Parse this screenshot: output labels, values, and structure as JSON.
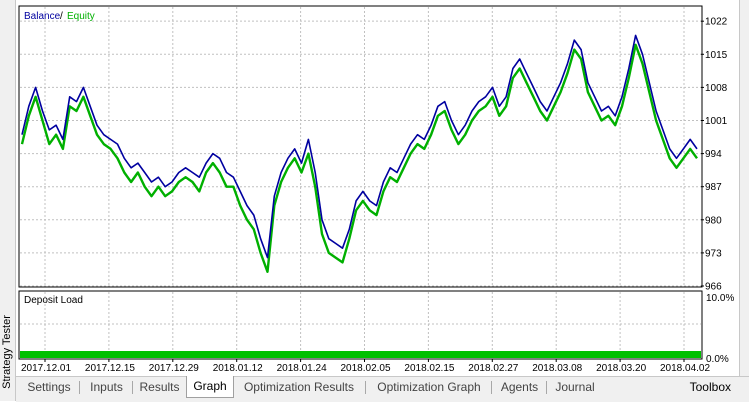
{
  "window": {
    "side_label": "Strategy Tester"
  },
  "legend": {
    "balance_label": "Balance",
    "separator": " / ",
    "equity_label": "Equity",
    "balance_color": "#0000a0",
    "equity_color": "#00b000"
  },
  "deposit_panel": {
    "title": "Deposit Load",
    "axis_top": "10.0%",
    "axis_bottom": "0.0%",
    "bar_color": "#00c000",
    "load_fraction": 0.02
  },
  "tabs": [
    {
      "label": "Settings",
      "active": false
    },
    {
      "label": "Inputs",
      "active": false
    },
    {
      "label": "Results",
      "active": false
    },
    {
      "label": "Graph",
      "active": true
    },
    {
      "label": "Optimization Results",
      "active": false
    },
    {
      "label": "Optimization Graph",
      "active": false
    },
    {
      "label": "Agents",
      "active": false
    },
    {
      "label": "Journal",
      "active": false
    }
  ],
  "toolbox_label": "Toolbox",
  "chart_data": {
    "type": "line",
    "title": "",
    "xlabel": "",
    "ylabel": "",
    "x_tick_labels": [
      "2017.12.01",
      "2017.12.15",
      "2017.12.29",
      "2018.01.12",
      "2018.01.24",
      "2018.02.05",
      "2018.02.15",
      "2018.02.27",
      "2018.03.08",
      "2018.03.20",
      "2018.04.02"
    ],
    "y_tick_labels": [
      "1022",
      "1015",
      "1008",
      "1001",
      "994",
      "987",
      "980",
      "973",
      "966"
    ],
    "ylim": [
      966,
      1025
    ],
    "grid": true,
    "legend_position": "top-left",
    "series": [
      {
        "name": "Balance",
        "color": "#0000a0",
        "values": [
          998,
          1004,
          1008,
          1003,
          999,
          1000,
          997,
          1006,
          1005,
          1008,
          1004,
          1000,
          998,
          997,
          996,
          993,
          991,
          992,
          990,
          988,
          989,
          987,
          988,
          990,
          991,
          990,
          989,
          992,
          994,
          993,
          990,
          989,
          986,
          983,
          981,
          976,
          972,
          985,
          990,
          993,
          995,
          992,
          997,
          990,
          980,
          976,
          975,
          974,
          978,
          984,
          986,
          984,
          983,
          988,
          991,
          990,
          993,
          996,
          998,
          997,
          1000,
          1004,
          1005,
          1001,
          998,
          1000,
          1003,
          1005,
          1006,
          1008,
          1004,
          1006,
          1012,
          1014,
          1011,
          1008,
          1005,
          1003,
          1006,
          1009,
          1013,
          1018,
          1016,
          1009,
          1006,
          1003,
          1004,
          1002,
          1006,
          1012,
          1019,
          1015,
          1009,
          1003,
          999,
          995,
          993,
          995,
          997,
          995
        ]
      },
      {
        "name": "Equity",
        "color": "#00b000",
        "values": [
          996,
          1002,
          1006,
          1001,
          996,
          998,
          995,
          1004,
          1003,
          1006,
          1002,
          998,
          996,
          995,
          993,
          990,
          988,
          990,
          987,
          985,
          987,
          985,
          986,
          988,
          989,
          988,
          986,
          990,
          992,
          990,
          987,
          987,
          983,
          980,
          978,
          973,
          969,
          983,
          988,
          991,
          993,
          990,
          994,
          987,
          977,
          973,
          972,
          971,
          976,
          982,
          984,
          982,
          981,
          986,
          989,
          988,
          991,
          994,
          996,
          995,
          998,
          1002,
          1003,
          999,
          996,
          998,
          1001,
          1003,
          1004,
          1006,
          1002,
          1004,
          1010,
          1012,
          1009,
          1006,
          1003,
          1001,
          1004,
          1007,
          1011,
          1016,
          1014,
          1007,
          1004,
          1001,
          1002,
          1000,
          1004,
          1010,
          1017,
          1013,
          1007,
          1001,
          997,
          993,
          991,
          993,
          995,
          993
        ]
      }
    ]
  }
}
